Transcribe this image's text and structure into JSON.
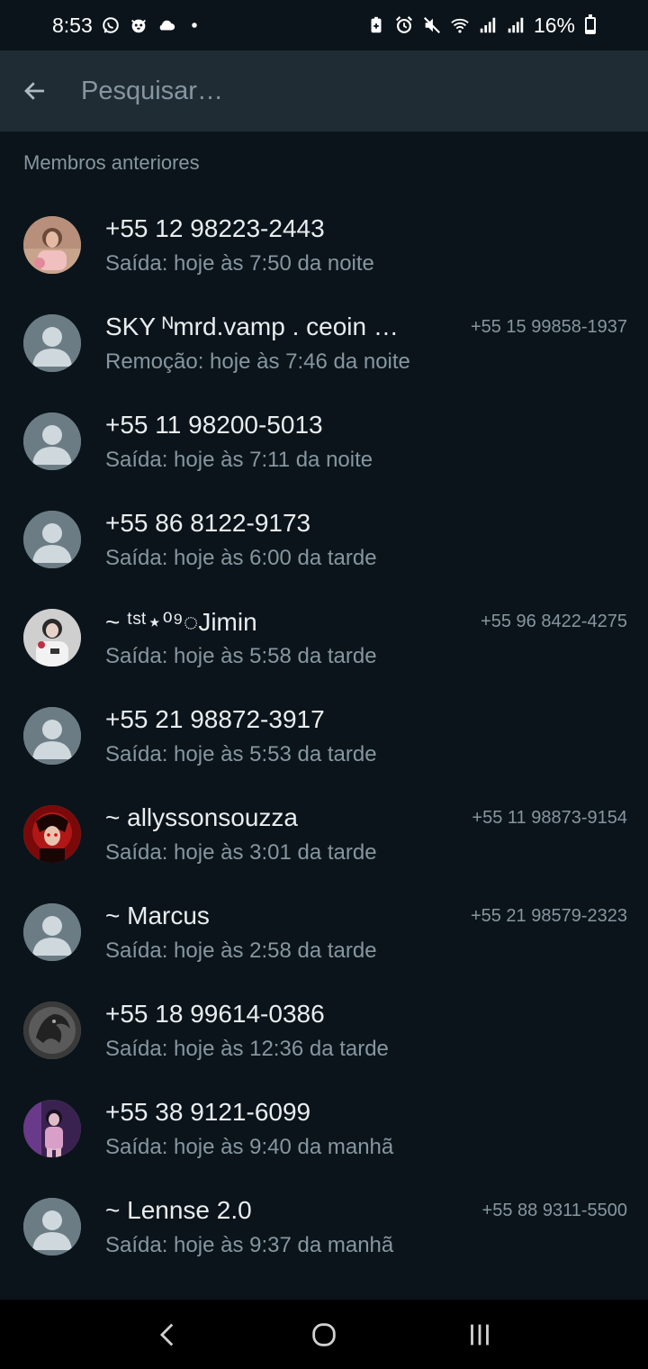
{
  "status_bar": {
    "time": "8:53",
    "battery": "16%",
    "battery_level": 0.16
  },
  "search": {
    "placeholder": "Pesquisar…"
  },
  "section_title": "Membros anteriores",
  "members": [
    {
      "name": "+55 12 98223-2443",
      "status": "Saída: hoje às 7:50 da noite",
      "phone": "",
      "avatar": "photo-woman"
    },
    {
      "name": "SKY ᴺmrd.vamp  . ceoin …",
      "status": "Remoção: hoje às 7:46 da noite",
      "phone": "+55 15 99858-1937",
      "avatar": "default"
    },
    {
      "name": "+55 11 98200-5013",
      "status": "Saída: hoje às 7:11 da noite",
      "phone": "",
      "avatar": "default"
    },
    {
      "name": "+55 86 8122-9173",
      "status": "Saída: hoje às 6:00 da tarde",
      "phone": "",
      "avatar": "default"
    },
    {
      "name": "~ ᵗˢᵗ⋆⁰⁹◌Jimin",
      "status": "Saída: hoje às 5:58 da tarde",
      "phone": "+55 96 8422-4275",
      "avatar": "photo-white"
    },
    {
      "name": "+55 21 98872-3917",
      "status": "Saída: hoje às 5:53 da tarde",
      "phone": "",
      "avatar": "default"
    },
    {
      "name": "~ allyssonsouzza",
      "status": "Saída: hoje às 3:01 da tarde",
      "phone": "+55 11 98873-9154",
      "avatar": "photo-red"
    },
    {
      "name": "~ Marcus",
      "status": "Saída: hoje às 2:58 da tarde",
      "phone": "+55 21 98579-2323",
      "avatar": "default"
    },
    {
      "name": "+55 18 99614-0386",
      "status": "Saída: hoje às 12:36 da tarde",
      "phone": "",
      "avatar": "photo-dragon"
    },
    {
      "name": "+55 38 9121-6099",
      "status": "Saída: hoje às 9:40 da manhã",
      "phone": "",
      "avatar": "photo-purple"
    },
    {
      "name": "~ Lennse 2.0",
      "status": "Saída: hoje às 9:37 da manhã",
      "phone": "+55 88 9311-5500",
      "avatar": "default"
    }
  ],
  "colors": {
    "background": "#0b141a",
    "header": "#1f2c34",
    "secondary_text": "#8696a0",
    "primary_text": "#e9edef"
  }
}
